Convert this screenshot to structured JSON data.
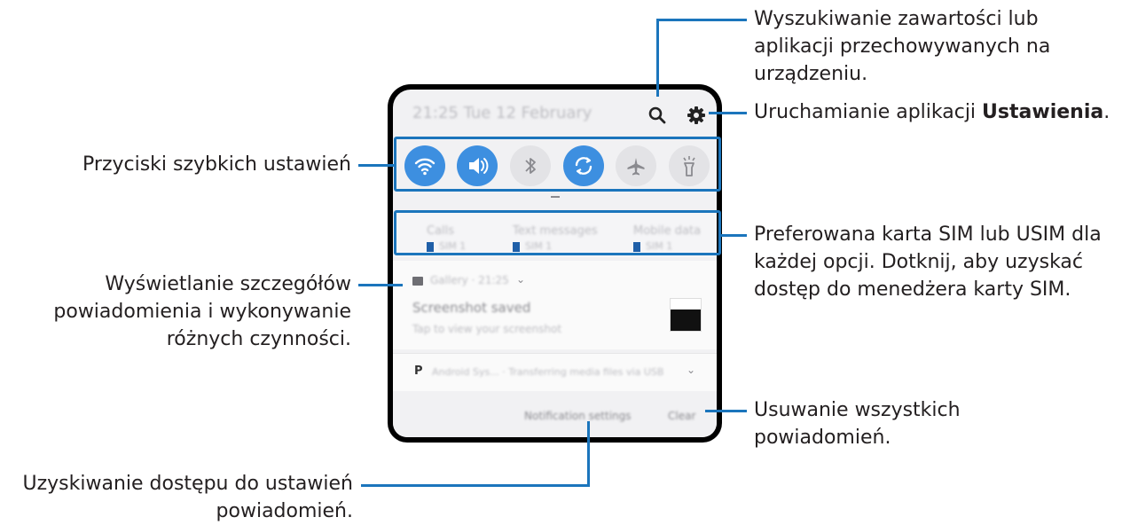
{
  "status_bar": {
    "time_date": "21:25 Tue 12 February"
  },
  "icons": {
    "search": "search-icon",
    "settings": "gear-icon",
    "quick_tiles": [
      "wifi-icon",
      "sound-icon",
      "bluetooth-icon",
      "auto-rotate-icon",
      "airplane-mode-icon",
      "flashlight-icon"
    ]
  },
  "sim_preferences": [
    {
      "label": "Calls",
      "sim": "SIM 1"
    },
    {
      "label": "Text messages",
      "sim": "SIM 1"
    },
    {
      "label": "Mobile data",
      "sim": "SIM 1"
    }
  ],
  "notification": {
    "app": "Gallery · 21:25",
    "title": "Screenshot saved",
    "text": "Tap to view your screenshot"
  },
  "notification2": {
    "app": "Android Sys... · Transferring media files via USB"
  },
  "footer": {
    "settings_label": "Notification settings",
    "clear_label": "Clear"
  },
  "annotations": {
    "search": [
      "Wyszukiwanie zawartości lub",
      "aplikacji przechowywanych na",
      "urządzeniu."
    ],
    "settings_prefix": "Uruchamianie aplikacji ",
    "settings_bold": "Ustawienia",
    "settings_suffix": ".",
    "quick": "Przyciski szybkich ustawień",
    "sim": [
      "Preferowana karta SIM lub USIM dla",
      "każdej opcji. Dotknij, aby uzyskać",
      "dostęp do menedżera karty SIM."
    ],
    "details": [
      "Wyświetlanie szczegółów",
      "powiadomienia i wykonywanie",
      "różnych czynności."
    ],
    "clear": [
      "Usuwanie wszystkich",
      "powiadomień."
    ],
    "notif_settings": [
      "Uzyskiwanie dostępu do ustawień",
      "powiadomień."
    ]
  },
  "colors": {
    "accent": "#1b75bc",
    "tile_on": "#3d8fe0"
  }
}
